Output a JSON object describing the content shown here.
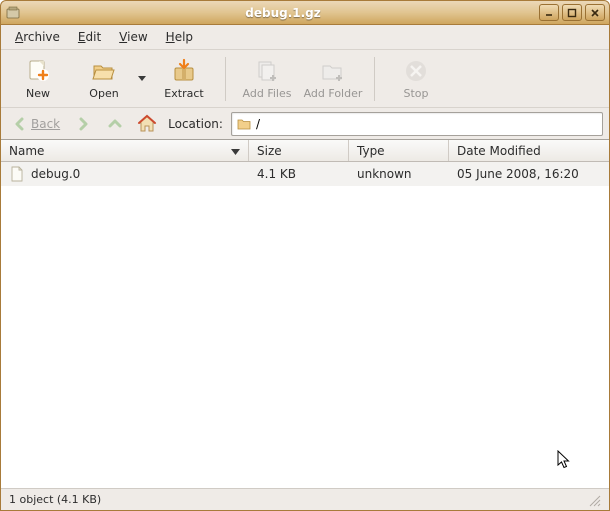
{
  "window": {
    "title": "debug.1.gz"
  },
  "menu": {
    "archive": "Archive",
    "edit": "Edit",
    "view": "View",
    "help": "Help"
  },
  "toolbar": {
    "new": "New",
    "open": "Open",
    "extract": "Extract",
    "add_files": "Add Files",
    "add_folder": "Add Folder",
    "stop": "Stop"
  },
  "nav": {
    "back": "Back",
    "location_label": "Location:",
    "location_value": "/"
  },
  "columns": {
    "name": "Name",
    "size": "Size",
    "type": "Type",
    "date": "Date Modified"
  },
  "files": [
    {
      "name": "debug.0",
      "size": "4.1 KB",
      "type": "unknown",
      "date": "05 June 2008, 16:20"
    }
  ],
  "status": {
    "text": "1 object (4.1 KB)"
  }
}
